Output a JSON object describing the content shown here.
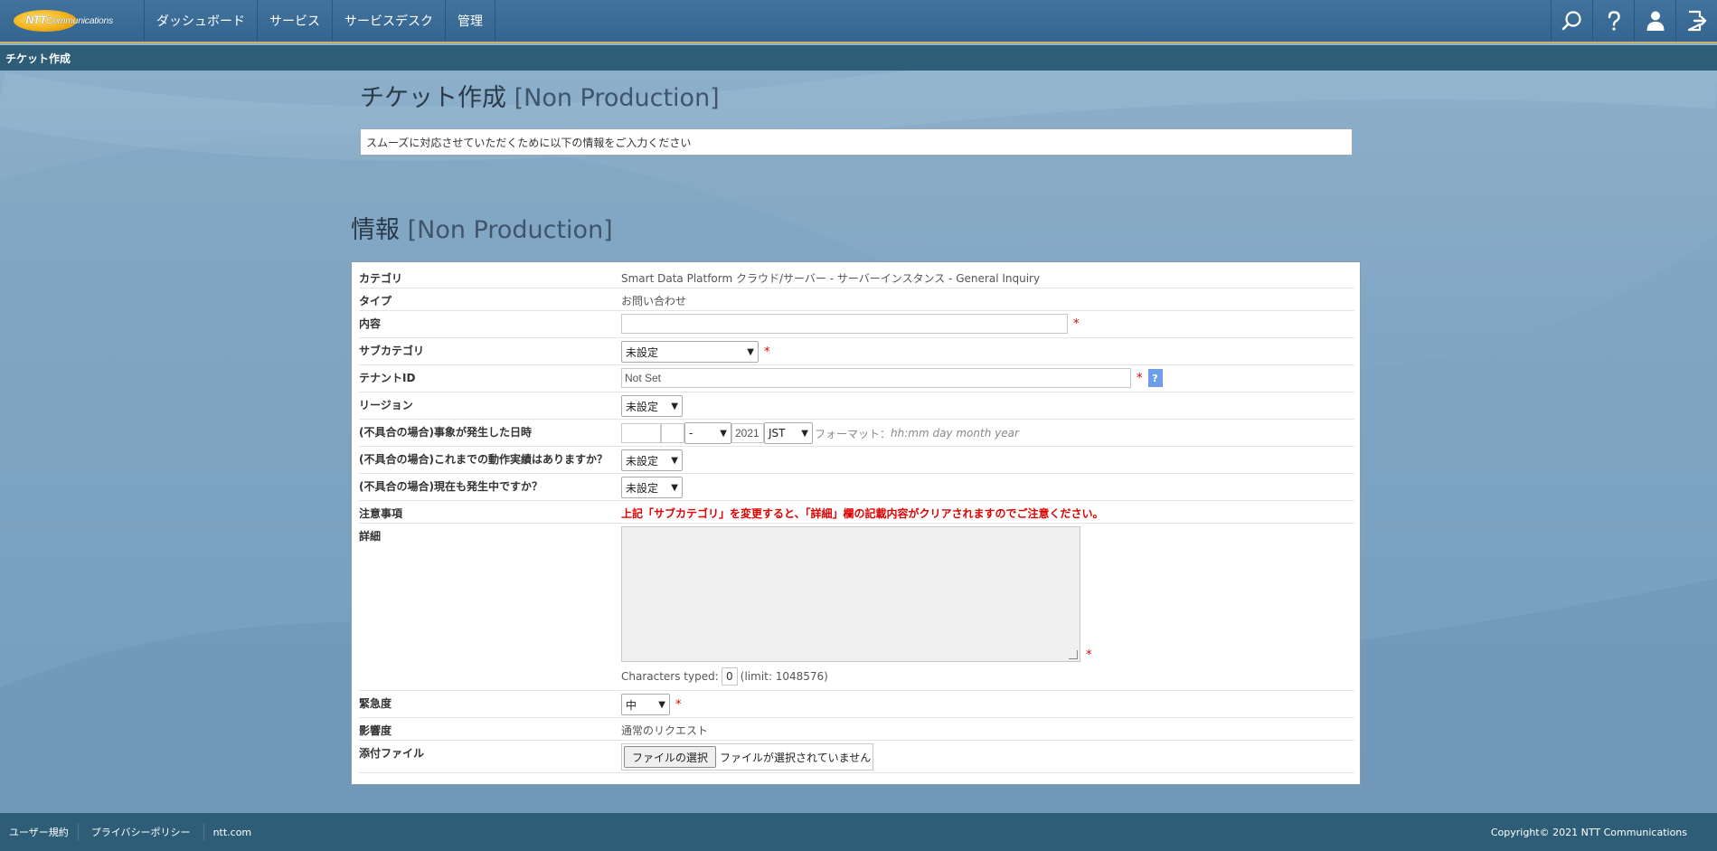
{
  "nav": {
    "logo_text": "NTT",
    "logo_text2": "Communications",
    "items": [
      "ダッシュボード",
      "サービス",
      "サービスデスク",
      "管理"
    ]
  },
  "subbar": {
    "title": "チケット作成"
  },
  "page": {
    "title": "チケット作成",
    "title_suffix": "[Non Production]",
    "notice": "スムーズに対応させていただくために以下の情報をご入力ください",
    "section_title": "情報",
    "section_suffix": "[Non Production]"
  },
  "form": {
    "category_label": "カテゴリ",
    "category_value": "Smart Data Platform クラウド/サーバー - サーバーインスタンス - General Inquiry",
    "type_label": "タイプ",
    "type_value": "お問い合わせ",
    "content_label": "内容",
    "content_value": "",
    "subcategory_label": "サブカテゴリ",
    "subcategory_value": "未設定",
    "tenant_label": "テナントID",
    "tenant_value": "Not Set",
    "tenant_help": "?",
    "region_label": "リージョン",
    "region_value": "未設定",
    "occurred_label": "(不具合の場合)事象が発生した日時",
    "occurred_month": "-",
    "occurred_year": "2021",
    "occurred_tz": "JST",
    "format_prefix": "フォーマット：",
    "format_hint": "hh:mm day month year",
    "history_label": "(不具合の場合)これまでの動作実績はありますか？",
    "history_value": "未設定",
    "ongoing_label": "(不具合の場合)現在も発生中ですか？",
    "ongoing_value": "未設定",
    "caution_label": "注意事項",
    "caution_text": "上記「サブカテゴリ」を変更すると、「詳細」欄の記載内容がクリアされますのでご注意ください。",
    "detail_label": "詳細",
    "chars_prefix": "Characters typed:",
    "chars_count": "0",
    "chars_limit": "(limit: 1048576)",
    "urgency_label": "緊急度",
    "urgency_value": "中",
    "impact_label": "影響度",
    "impact_value": "通常のリクエスト",
    "attach_label": "添付ファイル",
    "attach_button": "ファイルの選択",
    "attach_status": "ファイルが選択されていません"
  },
  "footer": {
    "terms": "ユーザー規約",
    "privacy": "プライバシーポリシー",
    "site": "ntt.com",
    "copyright": "Copyright© 2021 NTT Communications"
  },
  "colors": {
    "topbar": "#3a6c96",
    "subbar": "#2e5d78",
    "accent": "#c9b067",
    "required": "#dd0000"
  }
}
